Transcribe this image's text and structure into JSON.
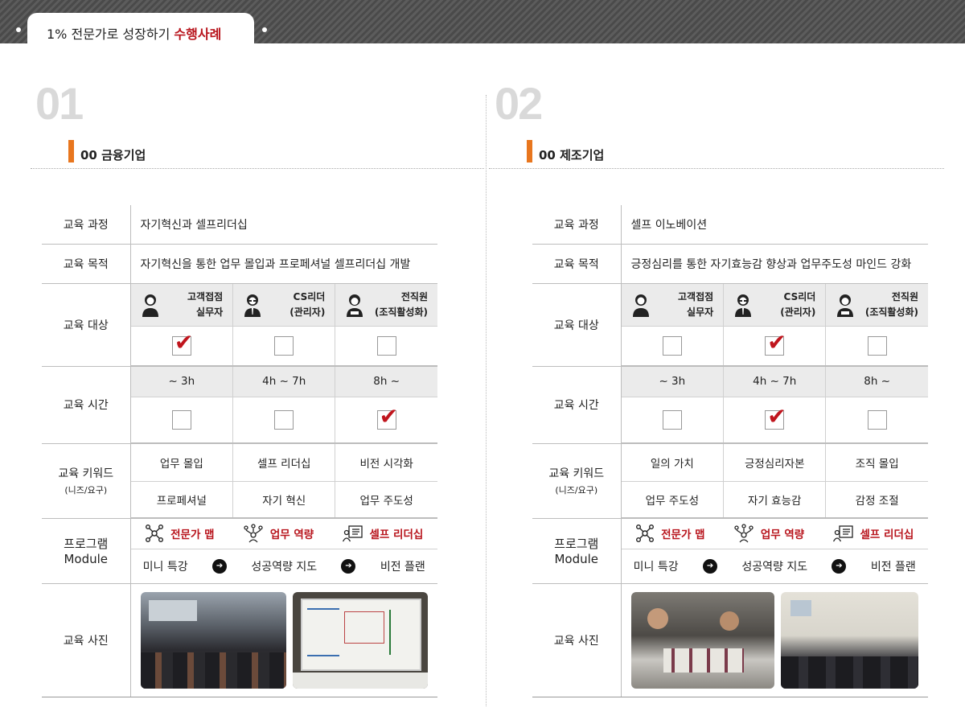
{
  "header": {
    "title_prefix": "1% 전문가로 성장하기 ",
    "title_accent": "수행사례"
  },
  "labels": {
    "course": "교육 과정",
    "purpose": "교육 목적",
    "target": "교육 대상",
    "time": "교육 시간",
    "keyword": "교육 키워드",
    "keyword_sub": "(니즈/요구)",
    "program": "프로그램",
    "program_sub": "Module",
    "photo": "교육 사진"
  },
  "targets": [
    {
      "line1": "고객접점",
      "line2": "실무자"
    },
    {
      "line1": "CS리더",
      "line2": "(관리자)"
    },
    {
      "line1": "전직원",
      "line2": "(조직활성화)"
    }
  ],
  "times": [
    "~ 3h",
    "4h ~ 7h",
    "8h ~"
  ],
  "programs": [
    "전문가 맵",
    "업무 역량",
    "셀프 리더십"
  ],
  "modules": [
    "미니 특강",
    "성공역량 지도",
    "비전 플랜"
  ],
  "cases": [
    {
      "number": "01",
      "section": "00 금융기업",
      "course": "자기혁신과 셀프리더십",
      "purpose": "자기혁신을 통한 업무 몰입과 프로페셔널 셀프리더십 개발",
      "target_checked": [
        true,
        false,
        false
      ],
      "time_checked": [
        false,
        false,
        true
      ],
      "keywords": [
        "업무 몰입",
        "셀프 리더십",
        "비전 시각화",
        "프로페셔널",
        "자기 혁신",
        "업무 주도성"
      ]
    },
    {
      "number": "02",
      "section": "00 제조기업",
      "course": "셀프 이노베이션",
      "purpose": "긍정심리를 통한 자기효능감 향상과 업무주도성 마인드 강화",
      "target_checked": [
        false,
        true,
        false
      ],
      "time_checked": [
        false,
        true,
        false
      ],
      "keywords": [
        "일의 가치",
        "긍정심리자본",
        "조직 몰입",
        "업무 주도성",
        "자기 효능감",
        "감정 조절"
      ]
    }
  ],
  "colors": {
    "accent": "#b8141c",
    "orange": "#e8761e",
    "check": "#c0151d"
  }
}
